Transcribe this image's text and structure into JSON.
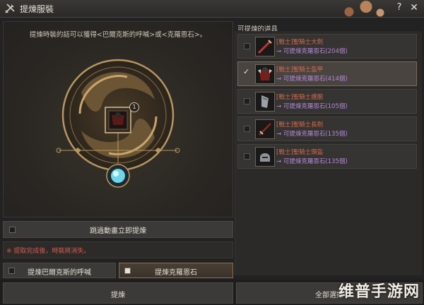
{
  "window": {
    "title": "提煉服裝",
    "help_label": "?",
    "close_label": "✕"
  },
  "left": {
    "hint": "提煉時裝的話可以獲得<巴爾克斯的呼喊>或<克羅恩石>。",
    "center_badge": "1",
    "action_button": "跳過動畫立即提煉",
    "warning": "※ 提取完成後，時裝將消失。",
    "option_a": "提煉巴爾克斯的呼喊",
    "option_b": "提煉克羅恩石"
  },
  "right": {
    "title": "可提煉的道具",
    "items": [
      {
        "name": "[戰士]聖騎士大劍",
        "sub": "→ 可提煉克羅恩石(204個)",
        "selected": false,
        "icon": "greatsword-icon"
      },
      {
        "name": "[戰士]聖騎士盔甲",
        "sub": "→ 可提煉克羅恩石(414個)",
        "selected": true,
        "icon": "armor-icon"
      },
      {
        "name": "[戰士]聖騎士護腕",
        "sub": "→ 可提煉克羅恩石(105個)",
        "selected": false,
        "icon": "gauntlet-icon"
      },
      {
        "name": "[戰士]聖騎士長劍",
        "sub": "→ 可提煉克羅恩石(135個)",
        "selected": false,
        "icon": "longsword-icon"
      },
      {
        "name": "[戰士]聖騎士頭盔",
        "sub": "→ 可提煉克羅恩石(135個)",
        "selected": false,
        "icon": "helmet-icon"
      }
    ]
  },
  "footer": {
    "refine_button": "提煉",
    "refine_all_button": "全部選擇"
  },
  "watermark": "维普手游网",
  "colors": {
    "item_name": "#d46a4a",
    "item_sub": "#b48ad6",
    "warning": "#d65a4e",
    "gold": "#b89660"
  }
}
